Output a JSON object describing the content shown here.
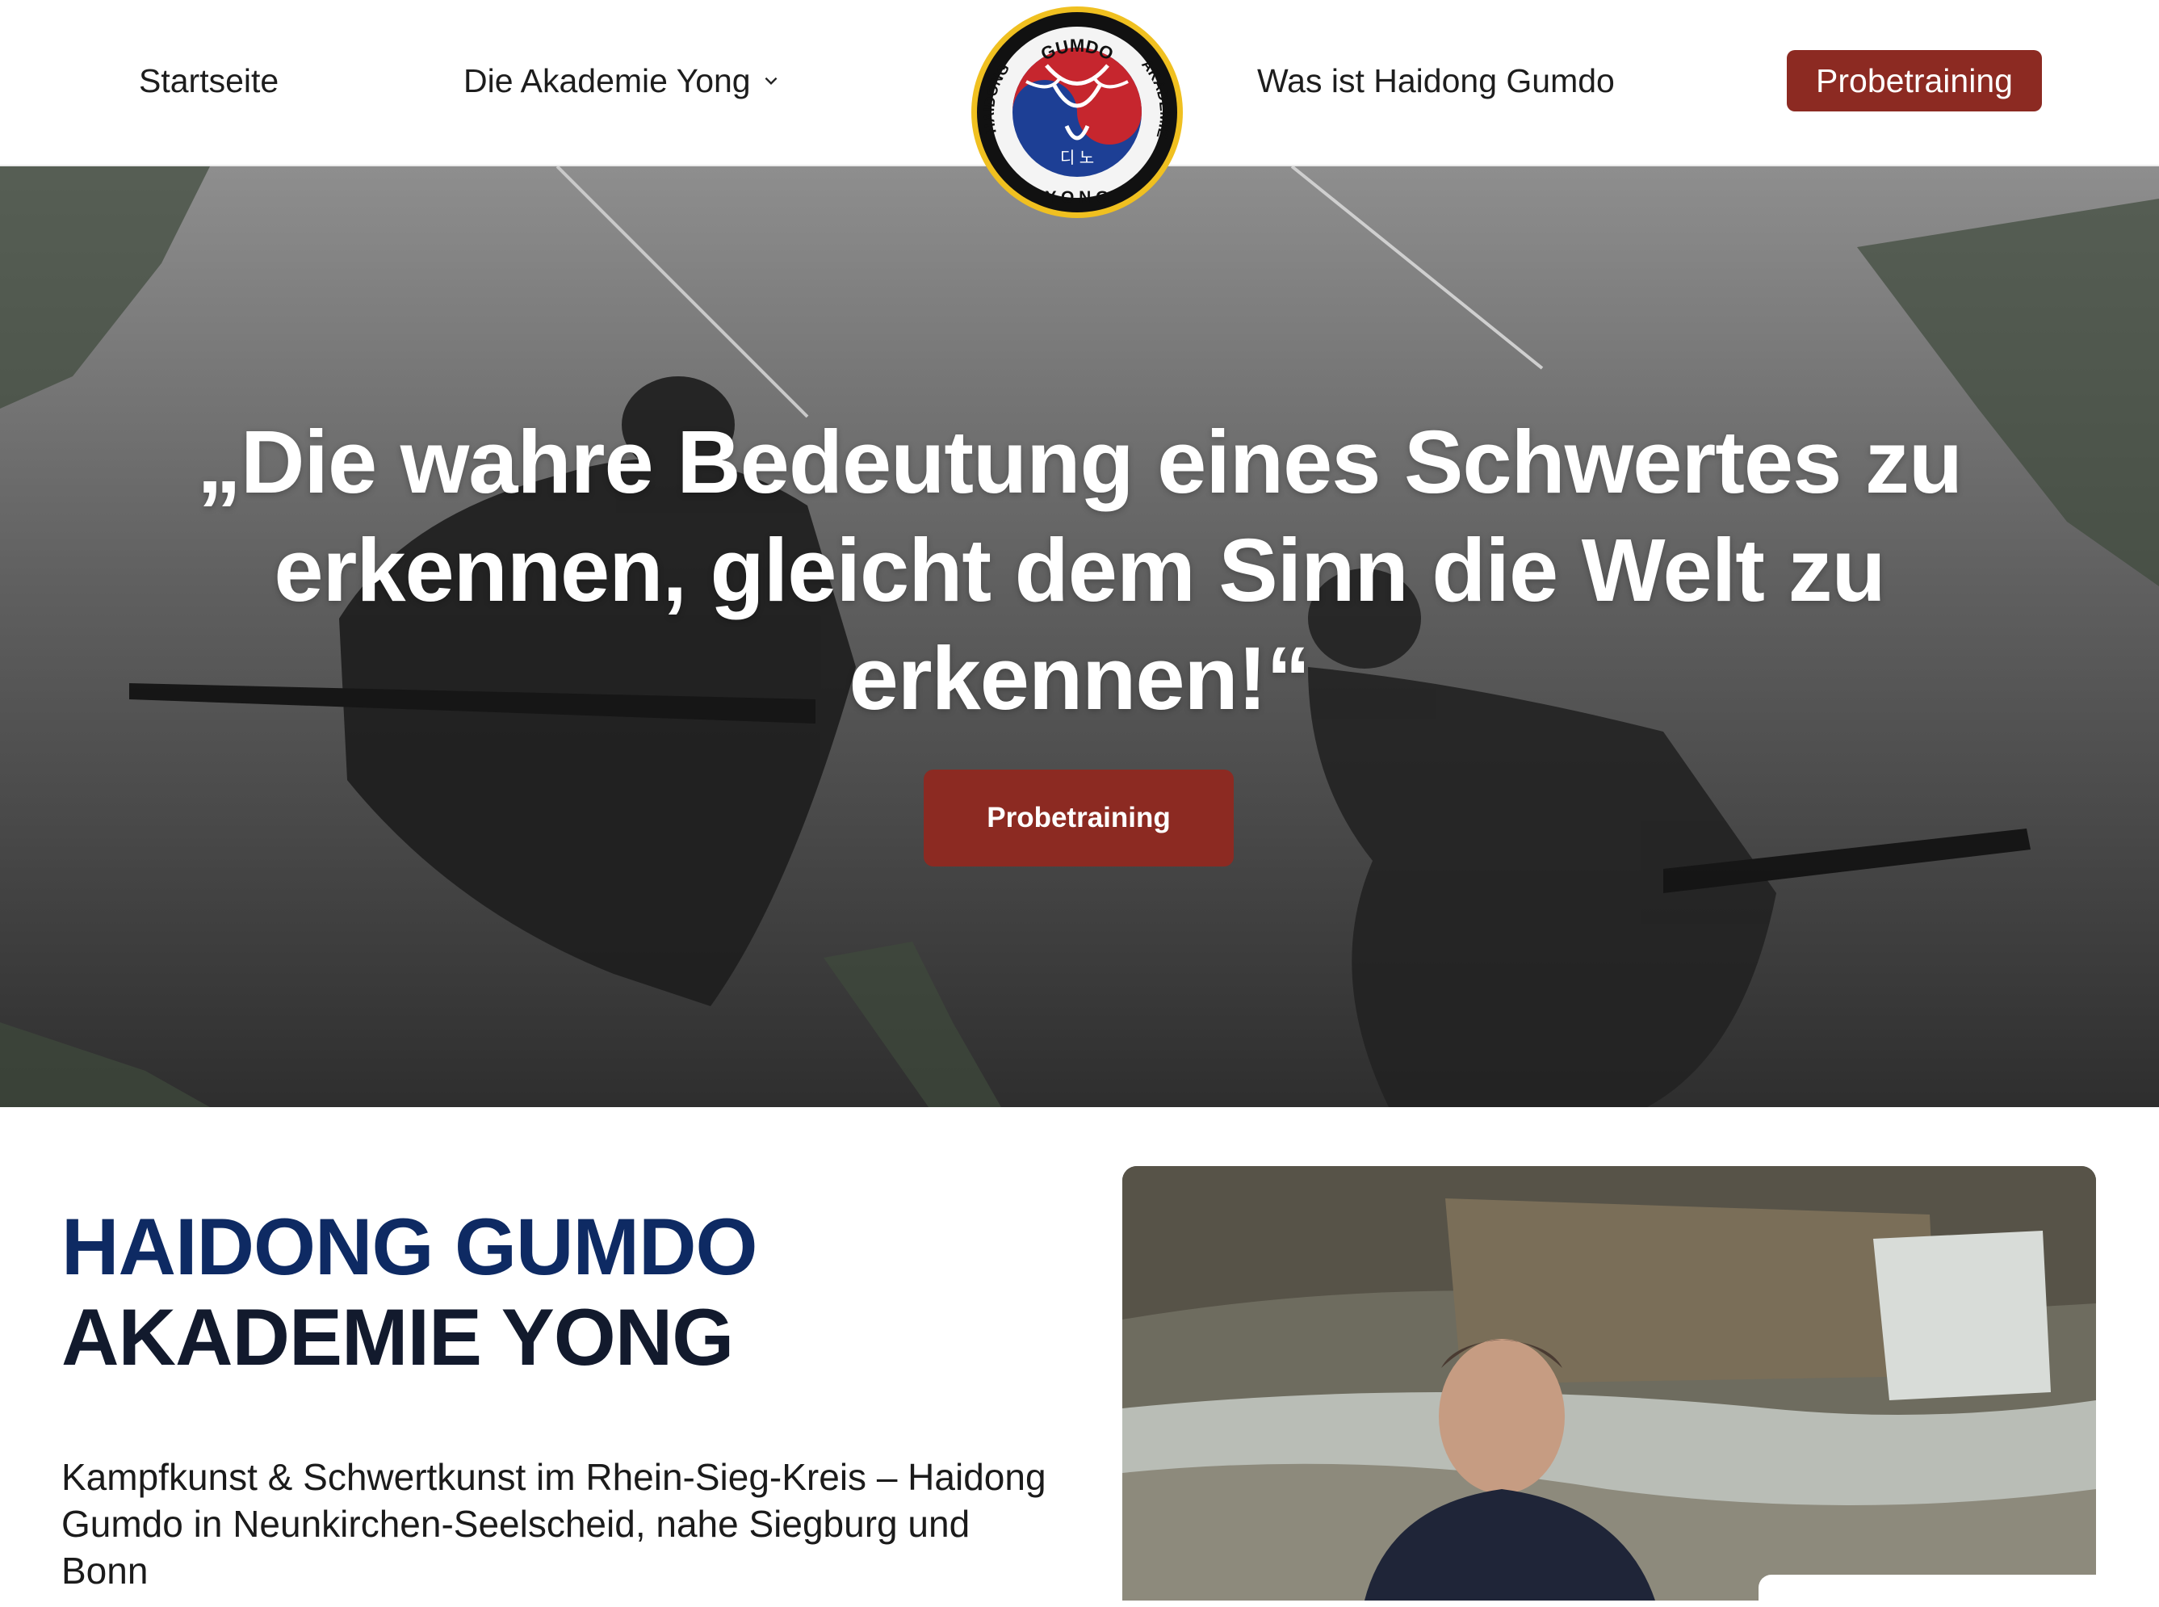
{
  "header": {
    "nav": {
      "home": "Startseite",
      "akademie": "Die Akademie Yong",
      "was_ist": "Was ist Haidong Gumdo",
      "cta": "Probetraining"
    },
    "logo": {
      "top_text": "GUMDO",
      "left_text": "HAIDONG",
      "right_text": "AKADEMIE",
      "bottom_text": "Y O N G",
      "hangul": "디 노"
    }
  },
  "hero": {
    "quote": "„Die wahre Bedeutung eines Schwertes zu erkennen, gleicht dem Sinn die Welt zu erkennen!“",
    "cta": "Probetraining"
  },
  "intro": {
    "title_line1": "HAIDONG GUMDO",
    "title_line2": "AKADEMIE YONG",
    "subtitle": "Kampfkunst & Schwertkunst im Rhein-Sieg-Kreis – Haidong Gumdo in Neunkirchen-Seelscheid, nahe Siegburg und Bonn"
  },
  "colors": {
    "accent_red": "#8c2a22",
    "title_navy": "#0e2a63",
    "title_dark": "#121a2d",
    "logo_blue": "#1d3f95",
    "logo_red": "#c6262e"
  },
  "icons": [
    "chevron-down-icon",
    "academy-logo"
  ]
}
